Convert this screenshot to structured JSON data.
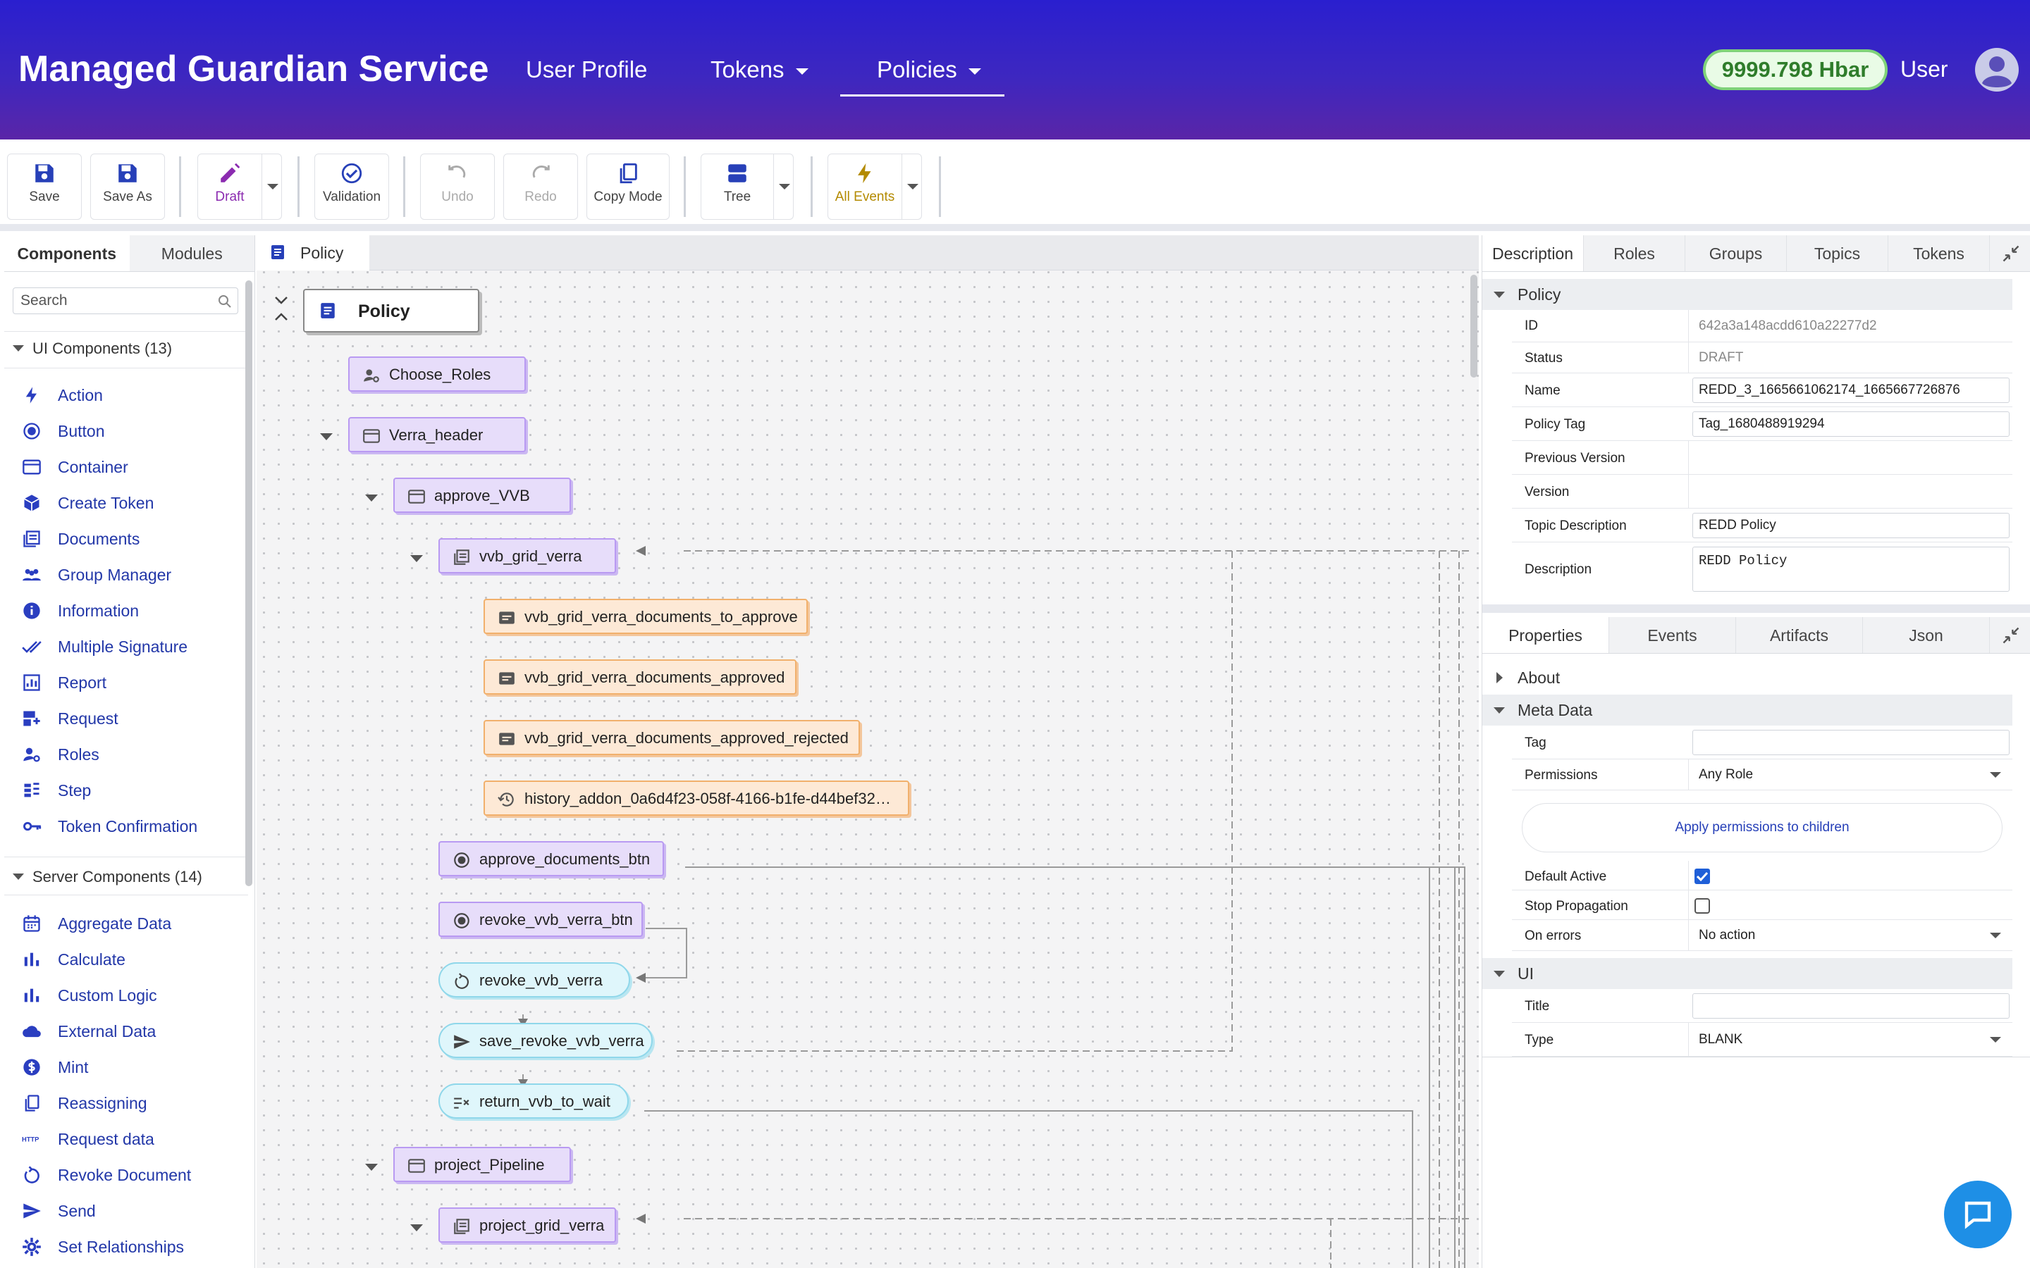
{
  "header": {
    "brand": "Managed Guardian Service",
    "nav": [
      {
        "label": "User Profile"
      },
      {
        "label": "Tokens"
      },
      {
        "label": "Policies"
      }
    ],
    "balance": "9999.798 Hbar",
    "user": "User",
    "accent": "#3d27c0"
  },
  "toolbar": {
    "save": "Save",
    "save_as": "Save As",
    "draft": "Draft",
    "validation": "Validation",
    "undo": "Undo",
    "redo": "Redo",
    "copy_mode": "Copy Mode",
    "tree": "Tree",
    "all_events": "All Events"
  },
  "left": {
    "tabs": [
      "Components",
      "Modules"
    ],
    "search_placeholder": "Search",
    "ui_section": "UI Components (13)",
    "ui_items": [
      {
        "label": "Action",
        "icon": "bolt-icon"
      },
      {
        "label": "Button",
        "icon": "radio-button-icon"
      },
      {
        "label": "Container",
        "icon": "window-icon"
      },
      {
        "label": "Create Token",
        "icon": "cube-icon"
      },
      {
        "label": "Documents",
        "icon": "grid-documents-icon"
      },
      {
        "label": "Group Manager",
        "icon": "people-icon"
      },
      {
        "label": "Information",
        "icon": "info-icon"
      },
      {
        "label": "Multiple Signature",
        "icon": "double-check-icon"
      },
      {
        "label": "Report",
        "icon": "report-icon"
      },
      {
        "label": "Request",
        "icon": "request-icon"
      },
      {
        "label": "Roles",
        "icon": "roles-icon"
      },
      {
        "label": "Step",
        "icon": "step-icon"
      },
      {
        "label": "Token Confirmation",
        "icon": "key-icon"
      }
    ],
    "server_section": "Server Components (14)",
    "server_items": [
      {
        "label": "Aggregate Data",
        "icon": "calendar-icon"
      },
      {
        "label": "Calculate",
        "icon": "bar-chart-icon"
      },
      {
        "label": "Custom Logic",
        "icon": "bar-chart-icon"
      },
      {
        "label": "External Data",
        "icon": "cloud-icon"
      },
      {
        "label": "Mint",
        "icon": "dollar-icon"
      },
      {
        "label": "Reassigning",
        "icon": "copy-icon"
      },
      {
        "label": "Request data",
        "icon": "http-icon"
      },
      {
        "label": "Revoke Document",
        "icon": "revoke-icon"
      },
      {
        "label": "Send",
        "icon": "send-icon"
      },
      {
        "label": "Set Relationships",
        "icon": "gear-icon"
      }
    ]
  },
  "center": {
    "tab": "Policy",
    "nodes": [
      {
        "label": "Policy"
      },
      {
        "label": "Choose_Roles"
      },
      {
        "label": "Verra_header"
      },
      {
        "label": "approve_VVB"
      },
      {
        "label": "vvb_grid_verra"
      },
      {
        "label": "vvb_grid_verra_documents_to_approve"
      },
      {
        "label": "vvb_grid_verra_documents_approved"
      },
      {
        "label": "vvb_grid_verra_documents_approved_rejected"
      },
      {
        "label": "history_addon_0a6d4f23-058f-4166-b1fe-d44bef32…"
      },
      {
        "label": "approve_documents_btn"
      },
      {
        "label": "revoke_vvb_verra_btn"
      },
      {
        "label": "revoke_vvb_verra"
      },
      {
        "label": "save_revoke_vvb_verra"
      },
      {
        "label": "return_vvb_to_wait"
      },
      {
        "label": "project_Pipeline"
      },
      {
        "label": "project_grid_verra"
      }
    ]
  },
  "right": {
    "top_tabs": [
      "Description",
      "Roles",
      "Groups",
      "Topics",
      "Tokens"
    ],
    "policy_section": "Policy",
    "fields": {
      "id_label": "ID",
      "id": "642a3a148acdd610a22277d2",
      "status_label": "Status",
      "status": "DRAFT",
      "name_label": "Name",
      "name": "REDD_3_1665661062174_1665667726876",
      "tag_label": "Policy Tag",
      "tag": "Tag_1680488919294",
      "prev_label": "Previous Version",
      "prev": "",
      "version_label": "Version",
      "version": "",
      "topic_label": "Topic Description",
      "topic": "REDD Policy",
      "desc_label": "Description",
      "desc": "REDD Policy"
    },
    "bottom_tabs": [
      "Properties",
      "Events",
      "Artifacts",
      "Json"
    ],
    "about": "About",
    "meta": "Meta Data",
    "meta_fields": {
      "tag_label": "Tag",
      "tag": "",
      "perm_label": "Permissions",
      "perm": "Any Role",
      "apply": "Apply permissions to children",
      "default_active": "Default Active",
      "stop_propagation": "Stop Propagation",
      "on_errors_label": "On errors",
      "on_errors": "No action"
    },
    "ui": "UI",
    "ui_fields": {
      "title_label": "Title",
      "title": "",
      "type_label": "Type",
      "type": "BLANK"
    }
  }
}
